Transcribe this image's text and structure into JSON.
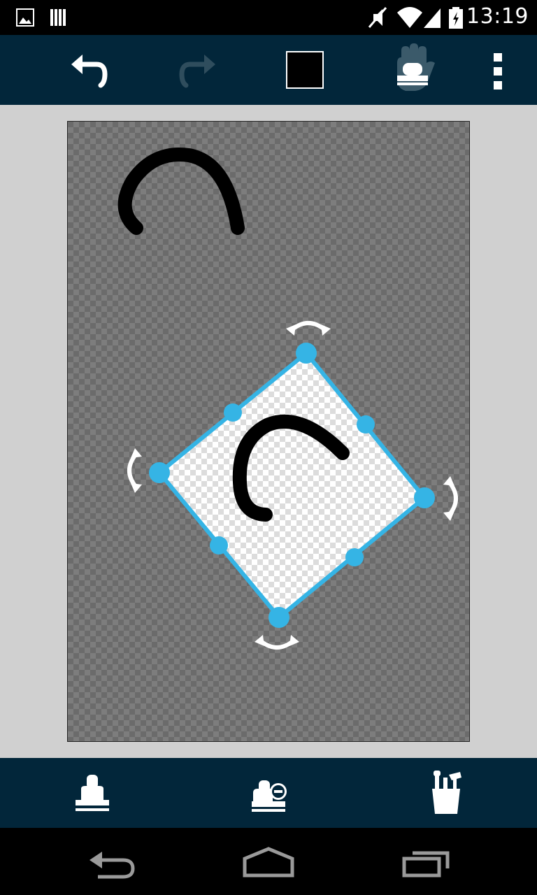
{
  "status_bar": {
    "time": "13:19",
    "icons": [
      "image-notification-icon",
      "storage-notification-icon",
      "mute-icon",
      "wifi-icon",
      "signal-icon",
      "battery-icon"
    ]
  },
  "toolbar": {
    "buttons": [
      "undo-icon",
      "redo-icon",
      "color-swatch",
      "stamp-hand-icon",
      "overflow-menu-icon"
    ],
    "current_color": "#000000",
    "redo_enabled": false
  },
  "canvas": {
    "background": "transparent-checkerboard",
    "selection_color": "#35b4e5"
  },
  "bottom_bar": {
    "buttons": [
      "stamp-icon",
      "stamp-remove-icon",
      "brushes-icon"
    ]
  },
  "nav_bar": {
    "buttons": [
      "back-icon",
      "home-icon",
      "recent-apps-icon"
    ]
  }
}
